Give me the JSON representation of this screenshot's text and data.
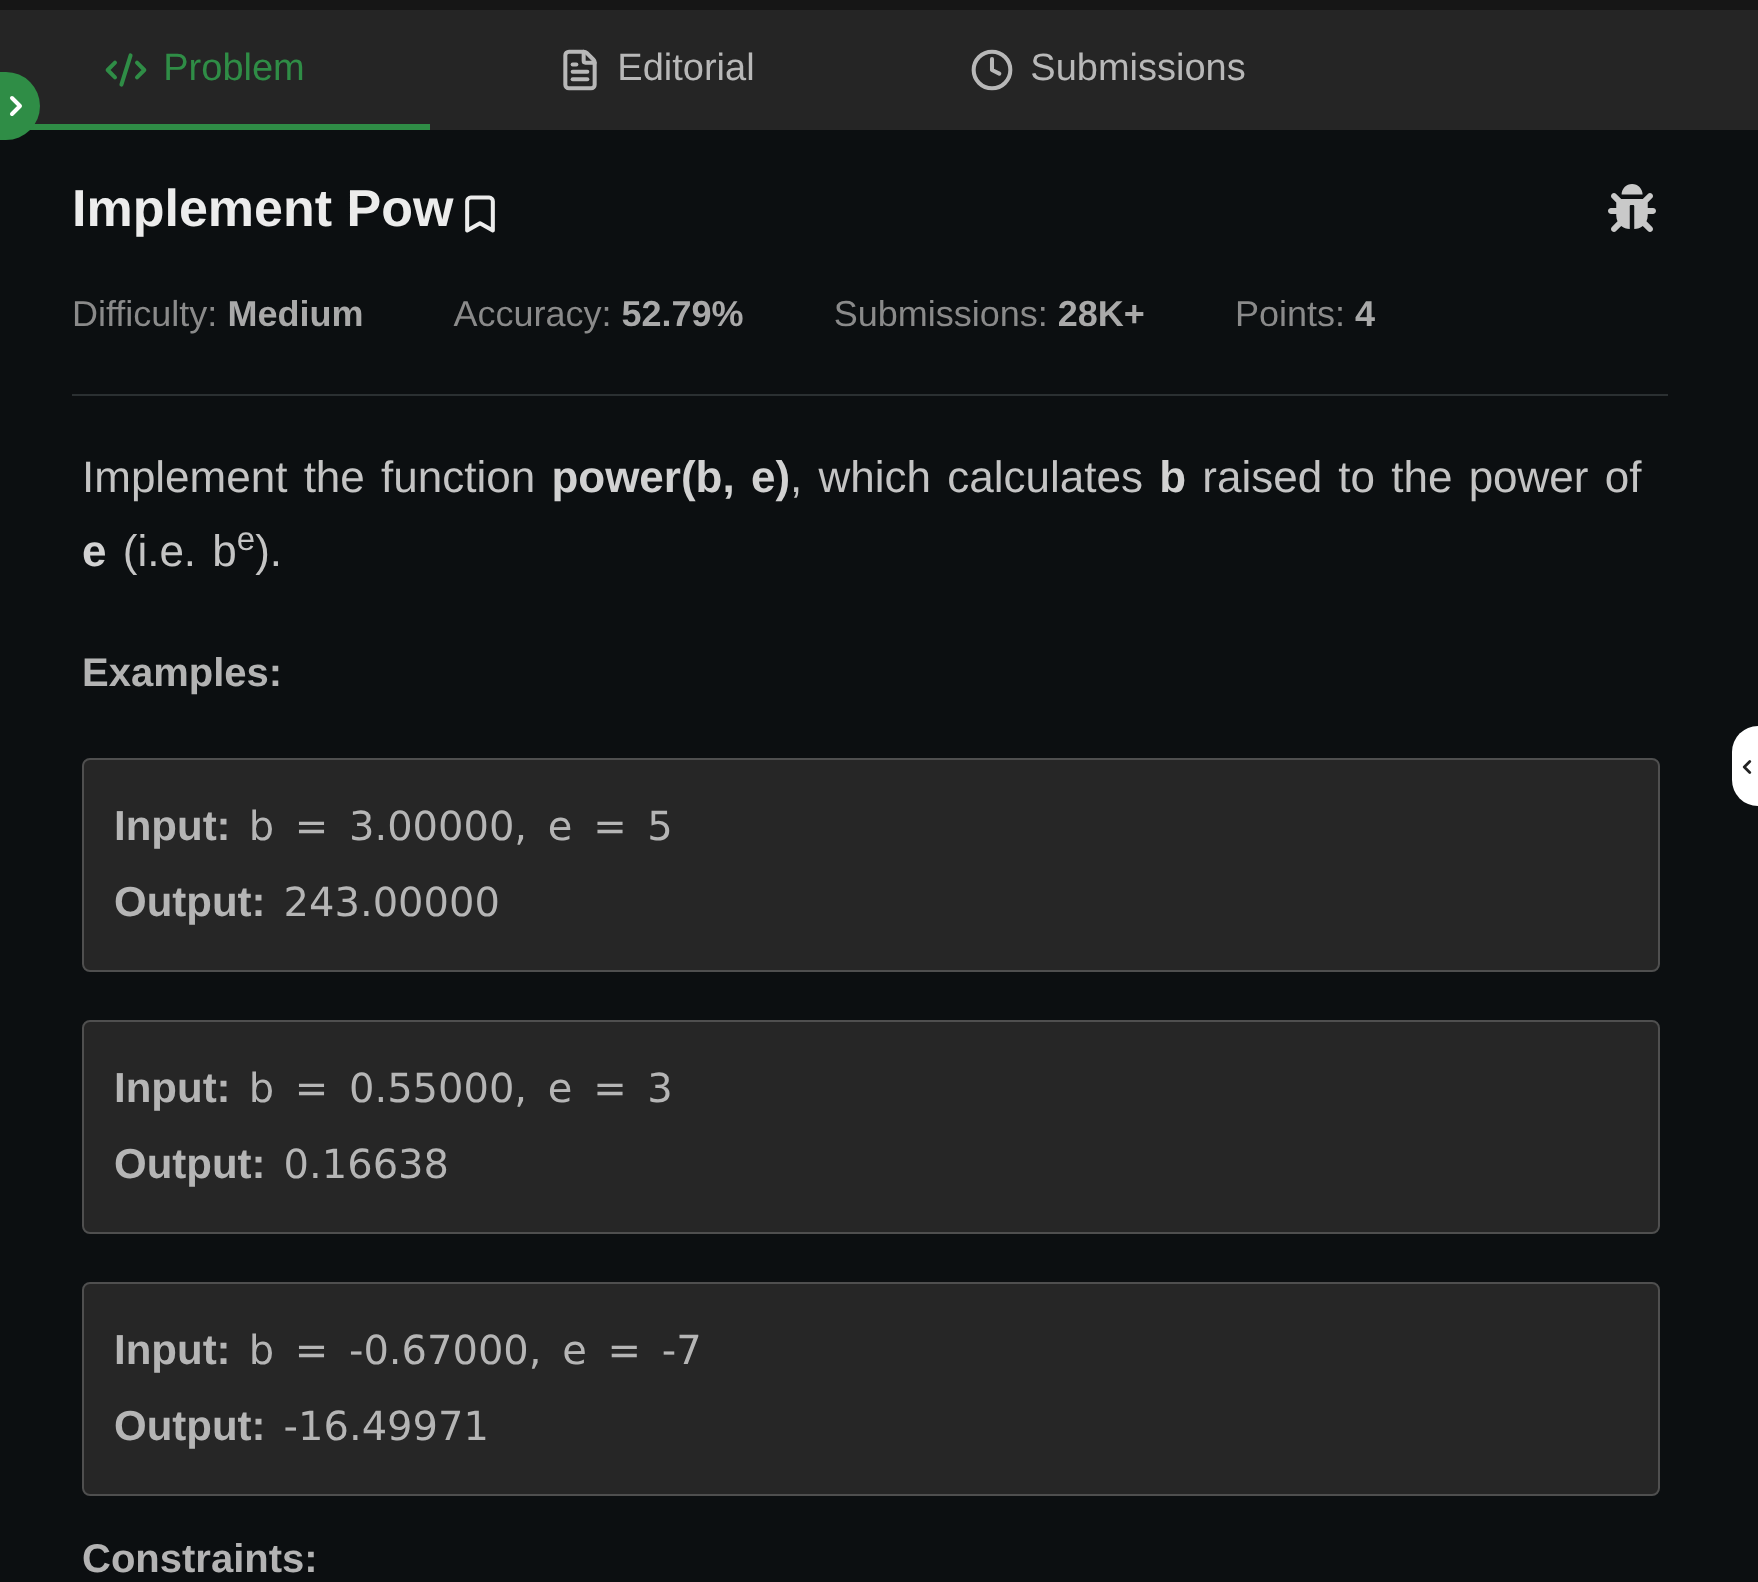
{
  "tabs": [
    {
      "label": "Problem",
      "selected": true
    },
    {
      "label": "Editorial",
      "selected": false
    },
    {
      "label": "Submissions",
      "selected": false
    }
  ],
  "problem": {
    "title": "Implement Pow",
    "meta": [
      {
        "label": "Difficulty:",
        "value": "Medium"
      },
      {
        "label": "Accuracy:",
        "value": "52.79%"
      },
      {
        "label": "Submissions:",
        "value": "28K+"
      },
      {
        "label": "Points:",
        "value": "4"
      }
    ],
    "description": "Implement the function **power(b, e)**, which calculates **b** raised to the power of **e** (i.e. b$^{e}$).",
    "examples_heading": "Examples:",
    "examples": [
      {
        "input_label": "Input:",
        "input": "b = 3.00000, e = 5",
        "output_label": "Output:",
        "output": "243.00000"
      },
      {
        "input_label": "Input:",
        "input": "b = 0.55000, e = 3",
        "output_label": "Output:",
        "output": "0.16638"
      },
      {
        "input_label": "Input:",
        "input": "b = -0.67000, e = -7",
        "output_label": "Output:",
        "output": "-16.49971"
      }
    ],
    "constraints_heading": "Constraints:"
  }
}
